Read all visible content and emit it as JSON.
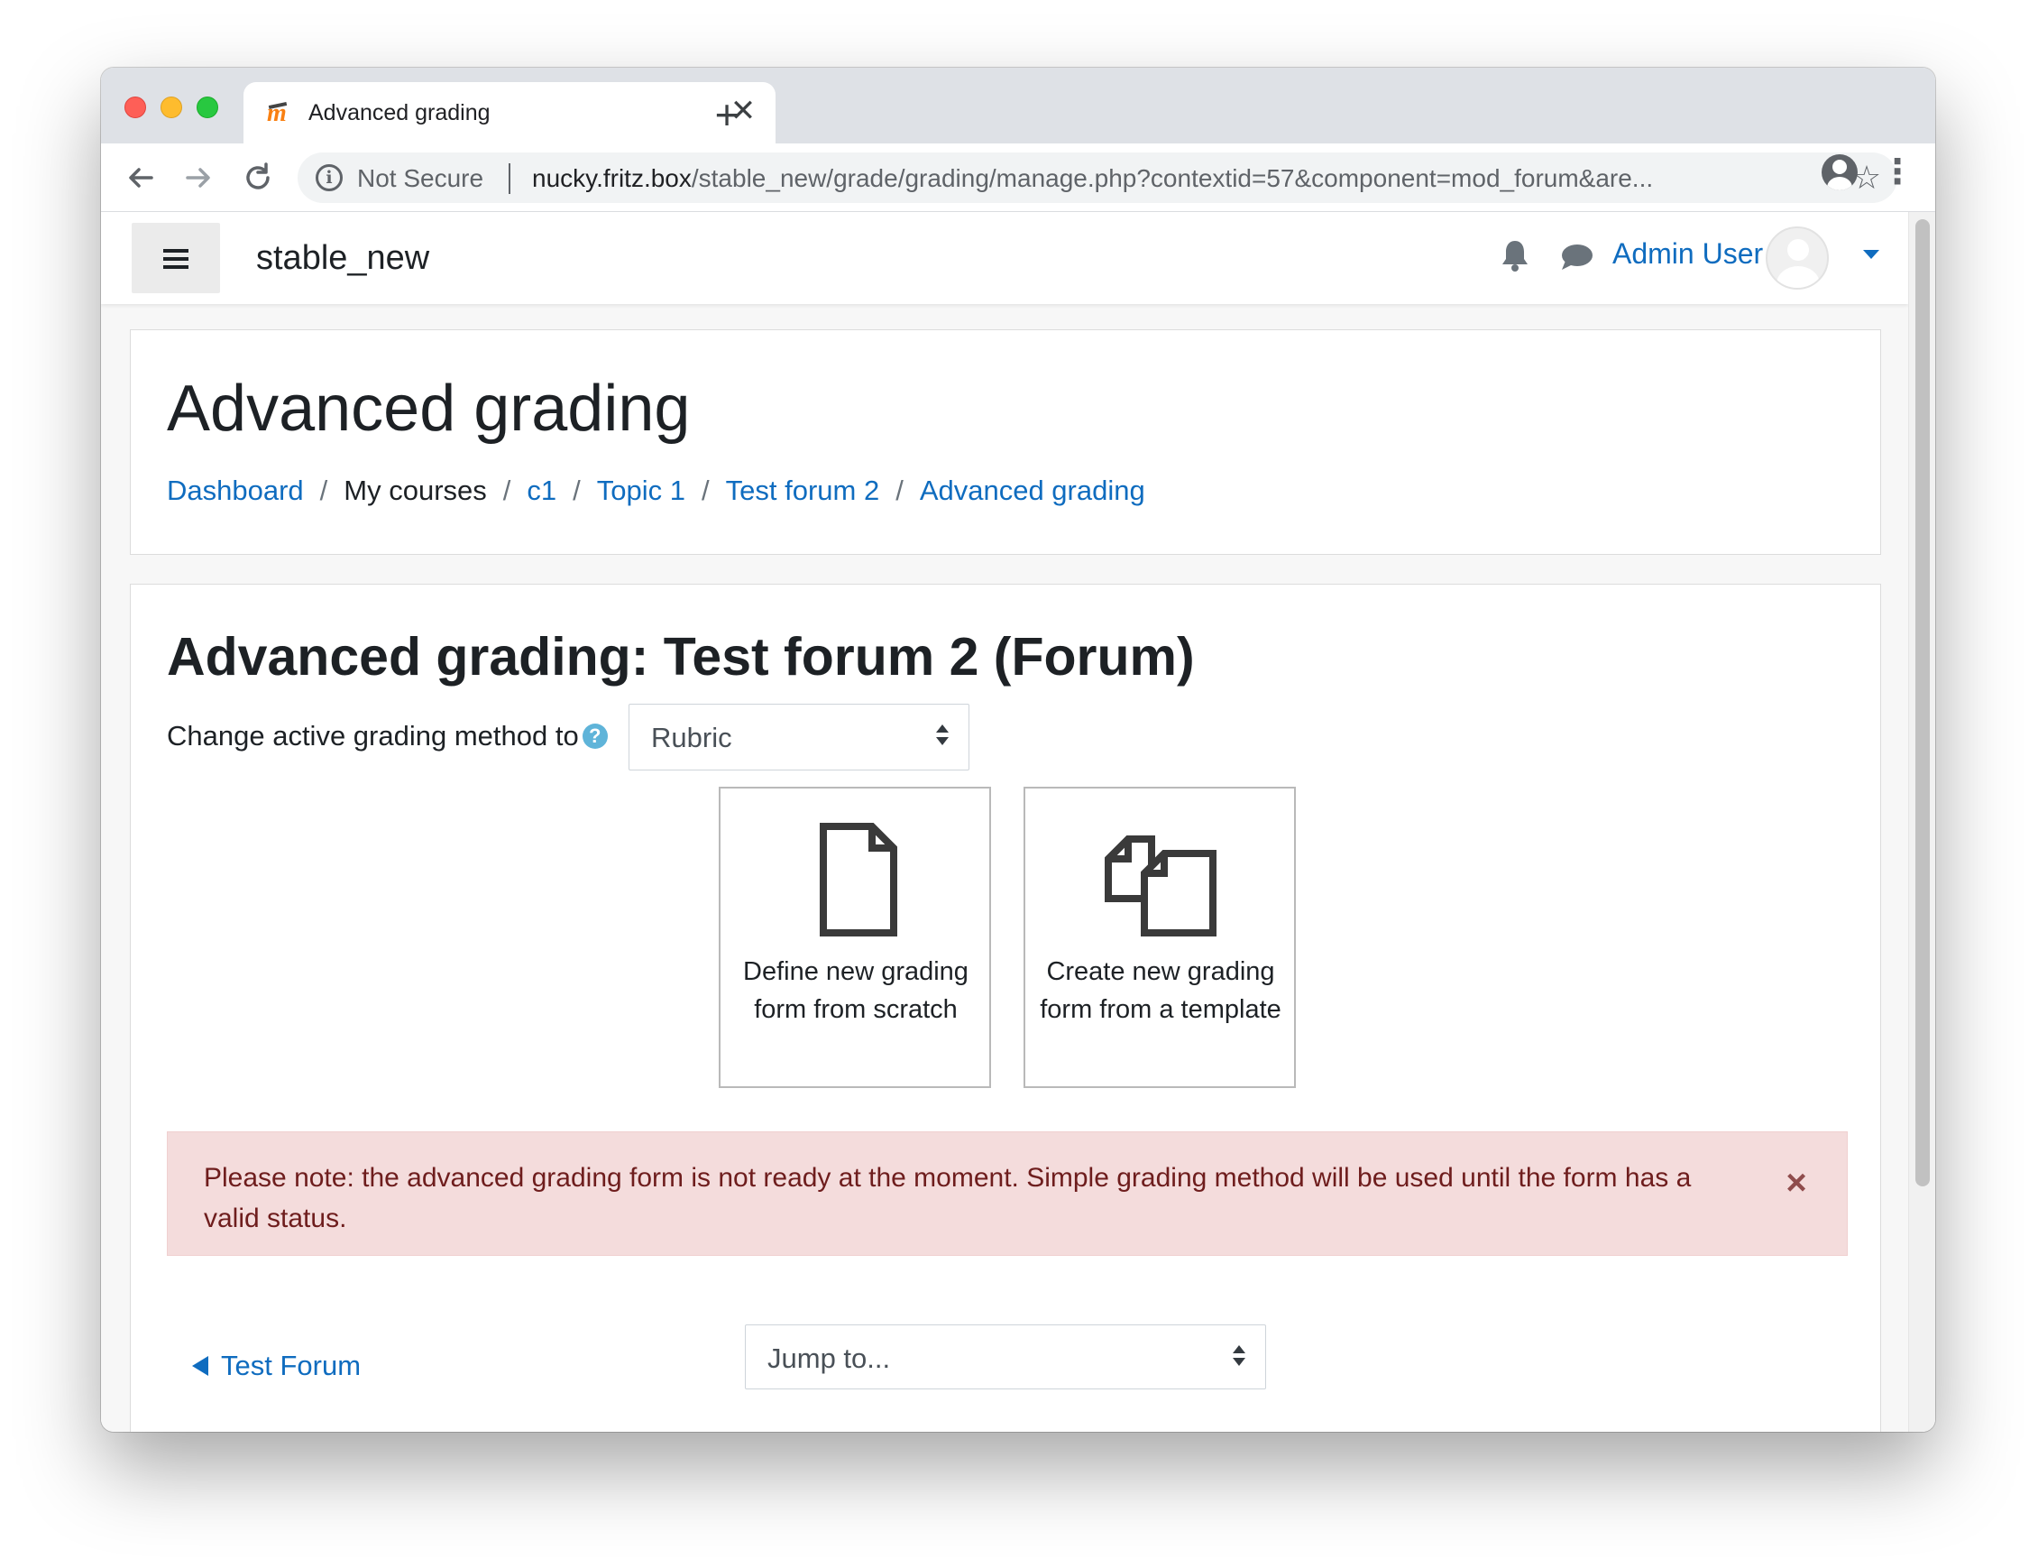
{
  "browser": {
    "tab_title": "Advanced grading",
    "tab_close": "✕",
    "new_tab": "+",
    "not_secure": "Not Secure",
    "url_host": "nucky.fritz.box",
    "url_path": "/stable_new/grade/grading/manage.php?contextid=57&component=mod_forum&are..."
  },
  "navbar": {
    "site_name": "stable_new",
    "user_name": "Admin User"
  },
  "header": {
    "title": "Advanced grading",
    "breadcrumb": [
      {
        "label": "Dashboard",
        "link": true
      },
      {
        "label": "My courses",
        "link": false
      },
      {
        "label": "c1",
        "link": true
      },
      {
        "label": "Topic 1",
        "link": true
      },
      {
        "label": "Test forum 2",
        "link": true
      },
      {
        "label": "Advanced grading",
        "link": true
      }
    ],
    "separator": "/"
  },
  "main": {
    "title": "Advanced grading: Test forum 2 (Forum)",
    "method_label": "Change active grading method to",
    "help_glyph": "?",
    "method_selected": "Rubric",
    "tiles": {
      "scratch": {
        "label": "Define new grading form from scratch",
        "icon": "file-icon"
      },
      "template": {
        "label": "Create new grading form from a template",
        "icon": "copy-icon"
      }
    },
    "alert": {
      "text": "Please note: the advanced grading form is not ready at the moment. Simple grading method will be used until the form has a valid status.",
      "close": "×"
    },
    "prev_link": "Test Forum",
    "jump_placeholder": "Jump to..."
  },
  "colors": {
    "link": "#0f6cbf",
    "alert_bg": "#f4dcdc",
    "alert_text": "#6e1d1d",
    "help": "#5fb4d9"
  }
}
